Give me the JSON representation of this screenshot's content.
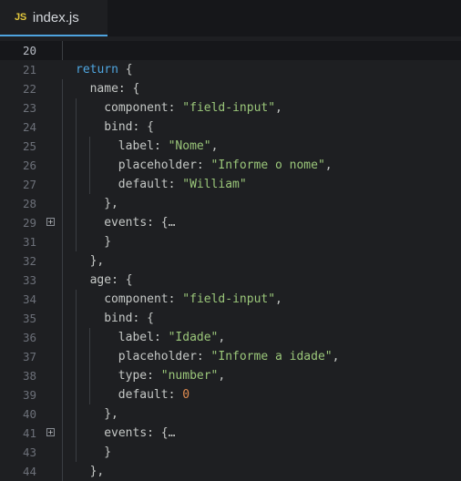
{
  "tab": {
    "icon_text": "JS",
    "filename": "index.js"
  },
  "colors": {
    "keyword": "#4fa6e0",
    "string": "#9bc77a",
    "number": "#e08c50",
    "tab_accent": "#4ea3df"
  },
  "lines": [
    {
      "num": "20",
      "indent": 0,
      "tokens": []
    },
    {
      "num": "21",
      "indent": 0,
      "tokens": [
        {
          "t": "return",
          "c": "kw"
        },
        {
          "t": " {",
          "c": "pun"
        }
      ]
    },
    {
      "num": "22",
      "indent": 1,
      "tokens": [
        {
          "t": "name",
          "c": "prop"
        },
        {
          "t": ": {",
          "c": "pun"
        }
      ]
    },
    {
      "num": "23",
      "indent": 2,
      "tokens": [
        {
          "t": "component",
          "c": "prop"
        },
        {
          "t": ": ",
          "c": "pun"
        },
        {
          "t": "\"field-input\"",
          "c": "str"
        },
        {
          "t": ",",
          "c": "pun"
        }
      ]
    },
    {
      "num": "24",
      "indent": 2,
      "tokens": [
        {
          "t": "bind",
          "c": "prop"
        },
        {
          "t": ": {",
          "c": "pun"
        }
      ]
    },
    {
      "num": "25",
      "indent": 3,
      "tokens": [
        {
          "t": "label",
          "c": "prop"
        },
        {
          "t": ": ",
          "c": "pun"
        },
        {
          "t": "\"Nome\"",
          "c": "str"
        },
        {
          "t": ",",
          "c": "pun"
        }
      ]
    },
    {
      "num": "26",
      "indent": 3,
      "tokens": [
        {
          "t": "placeholder",
          "c": "prop"
        },
        {
          "t": ": ",
          "c": "pun"
        },
        {
          "t": "\"Informe o nome\"",
          "c": "str"
        },
        {
          "t": ",",
          "c": "pun"
        }
      ]
    },
    {
      "num": "27",
      "indent": 3,
      "tokens": [
        {
          "t": "default",
          "c": "prop"
        },
        {
          "t": ": ",
          "c": "pun"
        },
        {
          "t": "\"William\"",
          "c": "str"
        }
      ]
    },
    {
      "num": "28",
      "indent": 2,
      "tokens": [
        {
          "t": "},",
          "c": "pun"
        }
      ]
    },
    {
      "num": "29",
      "indent": 2,
      "fold": "+",
      "tokens": [
        {
          "t": "events",
          "c": "prop"
        },
        {
          "t": ": {",
          "c": "pun"
        },
        {
          "t": "…",
          "c": "ell"
        }
      ]
    },
    {
      "num": "31",
      "indent": 2,
      "tokens": [
        {
          "t": "}",
          "c": "pun"
        }
      ]
    },
    {
      "num": "32",
      "indent": 1,
      "tokens": [
        {
          "t": "},",
          "c": "pun"
        }
      ]
    },
    {
      "num": "33",
      "indent": 1,
      "tokens": [
        {
          "t": "age",
          "c": "prop"
        },
        {
          "t": ": {",
          "c": "pun"
        }
      ]
    },
    {
      "num": "34",
      "indent": 2,
      "tokens": [
        {
          "t": "component",
          "c": "prop"
        },
        {
          "t": ": ",
          "c": "pun"
        },
        {
          "t": "\"field-input\"",
          "c": "str"
        },
        {
          "t": ",",
          "c": "pun"
        }
      ]
    },
    {
      "num": "35",
      "indent": 2,
      "tokens": [
        {
          "t": "bind",
          "c": "prop"
        },
        {
          "t": ": {",
          "c": "pun"
        }
      ]
    },
    {
      "num": "36",
      "indent": 3,
      "tokens": [
        {
          "t": "label",
          "c": "prop"
        },
        {
          "t": ": ",
          "c": "pun"
        },
        {
          "t": "\"Idade\"",
          "c": "str"
        },
        {
          "t": ",",
          "c": "pun"
        }
      ]
    },
    {
      "num": "37",
      "indent": 3,
      "tokens": [
        {
          "t": "placeholder",
          "c": "prop"
        },
        {
          "t": ": ",
          "c": "pun"
        },
        {
          "t": "\"Informe a idade\"",
          "c": "str"
        },
        {
          "t": ",",
          "c": "pun"
        }
      ]
    },
    {
      "num": "38",
      "indent": 3,
      "tokens": [
        {
          "t": "type",
          "c": "prop"
        },
        {
          "t": ": ",
          "c": "pun"
        },
        {
          "t": "\"number\"",
          "c": "str"
        },
        {
          "t": ",",
          "c": "pun"
        }
      ]
    },
    {
      "num": "39",
      "indent": 3,
      "tokens": [
        {
          "t": "default",
          "c": "prop"
        },
        {
          "t": ": ",
          "c": "pun"
        },
        {
          "t": "0",
          "c": "num"
        }
      ]
    },
    {
      "num": "40",
      "indent": 2,
      "tokens": [
        {
          "t": "},",
          "c": "pun"
        }
      ]
    },
    {
      "num": "41",
      "indent": 2,
      "fold": "+",
      "tokens": [
        {
          "t": "events",
          "c": "prop"
        },
        {
          "t": ": {",
          "c": "pun"
        },
        {
          "t": "…",
          "c": "ell"
        }
      ]
    },
    {
      "num": "43",
      "indent": 2,
      "tokens": [
        {
          "t": "}",
          "c": "pun"
        }
      ]
    },
    {
      "num": "44",
      "indent": 1,
      "tokens": [
        {
          "t": "},",
          "c": "pun"
        }
      ]
    }
  ]
}
